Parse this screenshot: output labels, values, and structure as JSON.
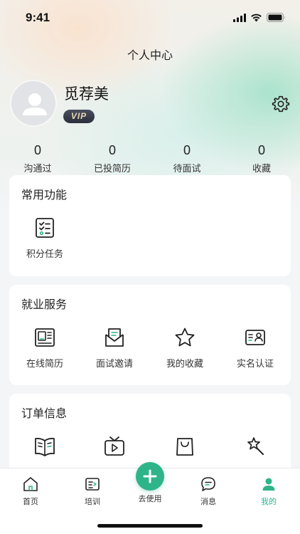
{
  "status_bar": {
    "time": "9:41"
  },
  "header": {
    "title": "个人中心"
  },
  "profile": {
    "name": "觅荐美",
    "badge": "VIP"
  },
  "stats": [
    {
      "value": "0",
      "label": "沟通过"
    },
    {
      "value": "0",
      "label": "已投简历"
    },
    {
      "value": "0",
      "label": "待面试"
    },
    {
      "value": "0",
      "label": "收藏"
    }
  ],
  "common_functions": {
    "title": "常用功能",
    "items": [
      {
        "label": "积分任务",
        "icon": "points-task-icon"
      }
    ]
  },
  "employment_services": {
    "title": "就业服务",
    "items": [
      {
        "label": "在线简历",
        "icon": "resume-icon"
      },
      {
        "label": "面试邀请",
        "icon": "interview-invite-icon"
      },
      {
        "label": "我的收藏",
        "icon": "star-icon"
      },
      {
        "label": "实名认证",
        "icon": "id-card-icon"
      }
    ]
  },
  "order_info": {
    "title": "订单信息",
    "items": [
      {
        "icon": "book-icon"
      },
      {
        "icon": "tv-play-icon"
      },
      {
        "icon": "shopping-bag-icon"
      },
      {
        "icon": "magic-wand-icon"
      }
    ]
  },
  "tabbar": {
    "items": [
      {
        "label": "首页",
        "icon": "home-icon",
        "active": false
      },
      {
        "label": "培训",
        "icon": "training-icon",
        "active": false
      },
      {
        "label": "去使用",
        "icon": "plus-icon",
        "active": false
      },
      {
        "label": "消息",
        "icon": "message-icon",
        "active": false
      },
      {
        "label": "我的",
        "icon": "user-icon",
        "active": true
      }
    ]
  },
  "colors": {
    "accent": "#2fb48a",
    "active_tab": "#2db38a",
    "vip_text": "#e8d9b5"
  }
}
